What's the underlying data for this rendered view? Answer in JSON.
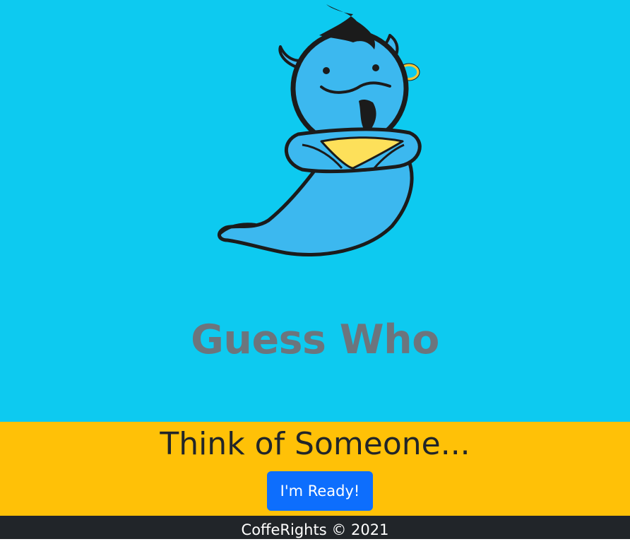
{
  "colors": {
    "hero_bg": "#0dcaf0",
    "title_text": "#6c757d",
    "band_bg": "#ffc107",
    "button_bg": "#0d6efd",
    "footer_bg": "#212529"
  },
  "hero": {
    "logo_icon": "genie-mascot-icon",
    "title": "Guess Who"
  },
  "prompt": {
    "text": "Think of Someone...",
    "button_label": "I'm Ready!"
  },
  "footer": {
    "text": "CoffeRights © 2021"
  }
}
